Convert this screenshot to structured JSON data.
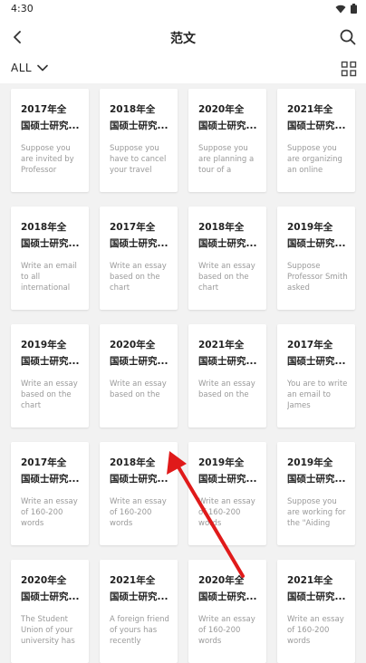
{
  "status": {
    "time": "4:30"
  },
  "header": {
    "title": "范文"
  },
  "filter": {
    "label": "ALL"
  },
  "cards": [
    {
      "year": "2017年全",
      "subtitle": "国硕士研究...",
      "excerpt": "Suppose you are invited by Professor"
    },
    {
      "year": "2018年全",
      "subtitle": "国硕士研究...",
      "excerpt": "Suppose you have to cancel your travel"
    },
    {
      "year": "2020年全",
      "subtitle": "国硕士研究...",
      "excerpt": "Suppose you are planning a tour of a"
    },
    {
      "year": "2021年全",
      "subtitle": "国硕士研究...",
      "excerpt": "Suppose you are organizing an online"
    },
    {
      "year": "2018年全",
      "subtitle": "国硕士研究...",
      "excerpt": "Write an email to all international"
    },
    {
      "year": "2017年全",
      "subtitle": "国硕士研究...",
      "excerpt": "Write an essay based on the chart"
    },
    {
      "year": "2018年全",
      "subtitle": "国硕士研究...",
      "excerpt": "Write an essay based on the chart"
    },
    {
      "year": "2019年全",
      "subtitle": "国硕士研究...",
      "excerpt": "Suppose Professor Smith asked"
    },
    {
      "year": "2019年全",
      "subtitle": "国硕士研究...",
      "excerpt": "Write an essay based on the chart"
    },
    {
      "year": "2020年全",
      "subtitle": "国硕士研究...",
      "excerpt": "Write an essay based on the"
    },
    {
      "year": "2021年全",
      "subtitle": "国硕士研究...",
      "excerpt": "Write an essay based on the"
    },
    {
      "year": "2017年全",
      "subtitle": "国硕士研究...",
      "excerpt": "You are to write an email to James"
    },
    {
      "year": "2017年全",
      "subtitle": "国硕士研究...",
      "excerpt": "Write an essay of 160-200 words"
    },
    {
      "year": "2018年全",
      "subtitle": "国硕士研究...",
      "excerpt": "Write an essay of 160-200 words"
    },
    {
      "year": "2019年全",
      "subtitle": "国硕士研究...",
      "excerpt": "Write an essay of 160-200 words"
    },
    {
      "year": "2019年全",
      "subtitle": "国硕士研究...",
      "excerpt": "Suppose you are working for the \"Aiding"
    },
    {
      "year": "2020年全",
      "subtitle": "国硕士研究...",
      "excerpt": "The Student Union of your university has"
    },
    {
      "year": "2021年全",
      "subtitle": "国硕士研究...",
      "excerpt": "A foreign friend of yours has recently"
    },
    {
      "year": "2020年全",
      "subtitle": "国硕士研究...",
      "excerpt": "Write an essay of 160-200 words"
    },
    {
      "year": "2021年全",
      "subtitle": "国硕士研究...",
      "excerpt": "Write an essay of 160-200 words"
    }
  ]
}
